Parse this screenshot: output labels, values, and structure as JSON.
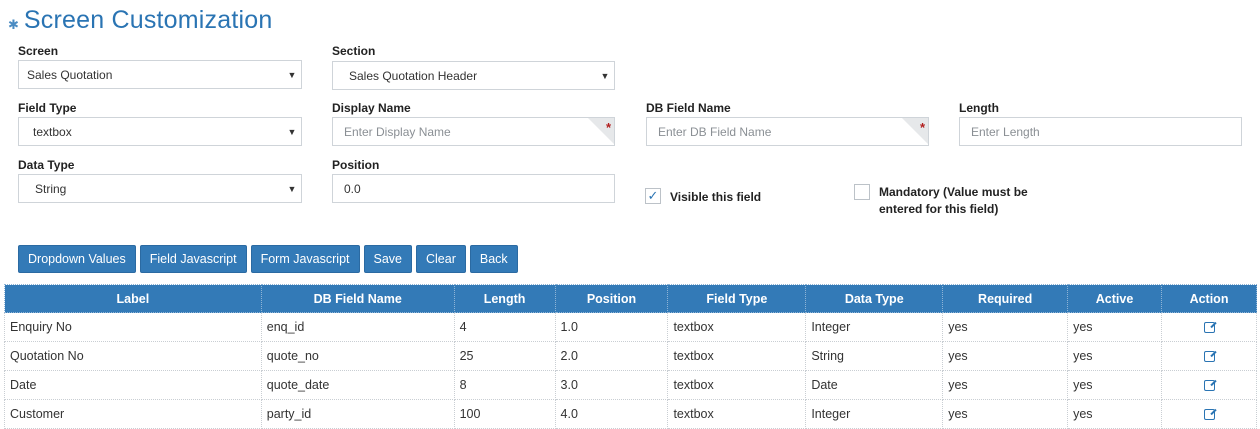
{
  "page": {
    "title": "Screen Customization",
    "title_icon": "gear-icon"
  },
  "form": {
    "screen": {
      "label": "Screen",
      "value": "Sales Quotation"
    },
    "section": {
      "label": "Section",
      "value": "Sales Quotation Header"
    },
    "field_type": {
      "label": "Field Type",
      "value": "textbox"
    },
    "display_name": {
      "label": "Display Name",
      "placeholder": "Enter Display Name",
      "required_mark": "*"
    },
    "db_field_name": {
      "label": "DB Field Name",
      "placeholder": "Enter DB Field Name",
      "required_mark": "*"
    },
    "length": {
      "label": "Length",
      "placeholder": "Enter Length"
    },
    "data_type": {
      "label": "Data Type",
      "value": "String"
    },
    "position": {
      "label": "Position",
      "value": "0.0"
    },
    "visible": {
      "label": "Visible this field",
      "checked": true
    },
    "mandatory": {
      "label_line1": "Mandatory (Value must be",
      "label_line2": "entered for this field)",
      "checked": false
    }
  },
  "buttons": {
    "dropdown_values": "Dropdown Values",
    "field_javascript": "Field Javascript",
    "form_javascript": "Form Javascript",
    "save": "Save",
    "clear": "Clear",
    "back": "Back"
  },
  "table": {
    "columns": [
      "Label",
      "DB Field Name",
      "Length",
      "Position",
      "Field Type",
      "Data Type",
      "Required",
      "Active",
      "Action"
    ],
    "rows": [
      [
        "Enquiry No",
        "enq_id",
        "4",
        "1.0",
        "textbox",
        "Integer",
        "yes",
        "yes"
      ],
      [
        "Quotation No",
        "quote_no",
        "25",
        "2.0",
        "textbox",
        "String",
        "yes",
        "yes"
      ],
      [
        "Date",
        "quote_date",
        "8",
        "3.0",
        "textbox",
        "Date",
        "yes",
        "yes"
      ],
      [
        "Customer",
        "party_id",
        "100",
        "4.0",
        "textbox",
        "Integer",
        "yes",
        "yes"
      ]
    ]
  },
  "colors": {
    "primary": "#337ab7",
    "title": "#2a74b3",
    "required": "#b21e1e"
  }
}
